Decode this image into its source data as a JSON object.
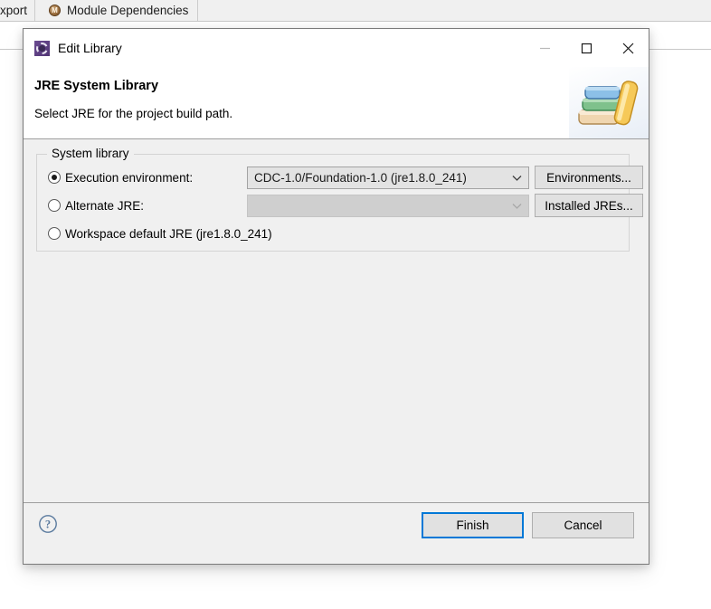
{
  "background": {
    "tabs": [
      {
        "label": "xport",
        "icon": null
      },
      {
        "label": "Module Dependencies",
        "icon": "module-icon",
        "icon_letter": "M"
      }
    ]
  },
  "dialog": {
    "titlebar": {
      "icon": "eclipse-gear-icon",
      "title": "Edit Library",
      "controls": [
        {
          "name": "minimize",
          "icon": "minimize-icon",
          "enabled": false
        },
        {
          "name": "maximize",
          "icon": "maximize-icon",
          "enabled": true
        },
        {
          "name": "close",
          "icon": "close-icon",
          "enabled": true
        }
      ]
    },
    "header": {
      "title": "JRE System Library",
      "description": "Select JRE for the project build path.",
      "banner_icon": "books-stack-icon"
    },
    "group": {
      "legend": "System library",
      "options": [
        {
          "id": "execution-environment",
          "label": "Execution environment:",
          "selected": true,
          "combo": {
            "value": "CDC-1.0/Foundation-1.0 (jre1.8.0_241)",
            "enabled": true,
            "chevron": "chevron-down-icon"
          },
          "button": "Environments..."
        },
        {
          "id": "alternate-jre",
          "label": "Alternate JRE:",
          "selected": false,
          "combo": {
            "value": "",
            "enabled": false,
            "chevron": "chevron-down-icon"
          },
          "button": "Installed JREs..."
        },
        {
          "id": "workspace-default-jre",
          "label": "Workspace default JRE (jre1.8.0_241)",
          "selected": false
        }
      ]
    },
    "footer": {
      "help_icon": "help-question-icon",
      "buttons": [
        {
          "label": "Finish",
          "default": true
        },
        {
          "label": "Cancel",
          "default": false
        }
      ]
    }
  },
  "colors": {
    "accent": "#0078d7",
    "dialog_bg": "#f0f0f0",
    "header_bg": "#ffffff",
    "border": "#7a7a7a",
    "combo_bg": "#e3e3e3",
    "combo_disabled_bg": "#cfcfcf",
    "help_icon": "#5a7a9e"
  }
}
